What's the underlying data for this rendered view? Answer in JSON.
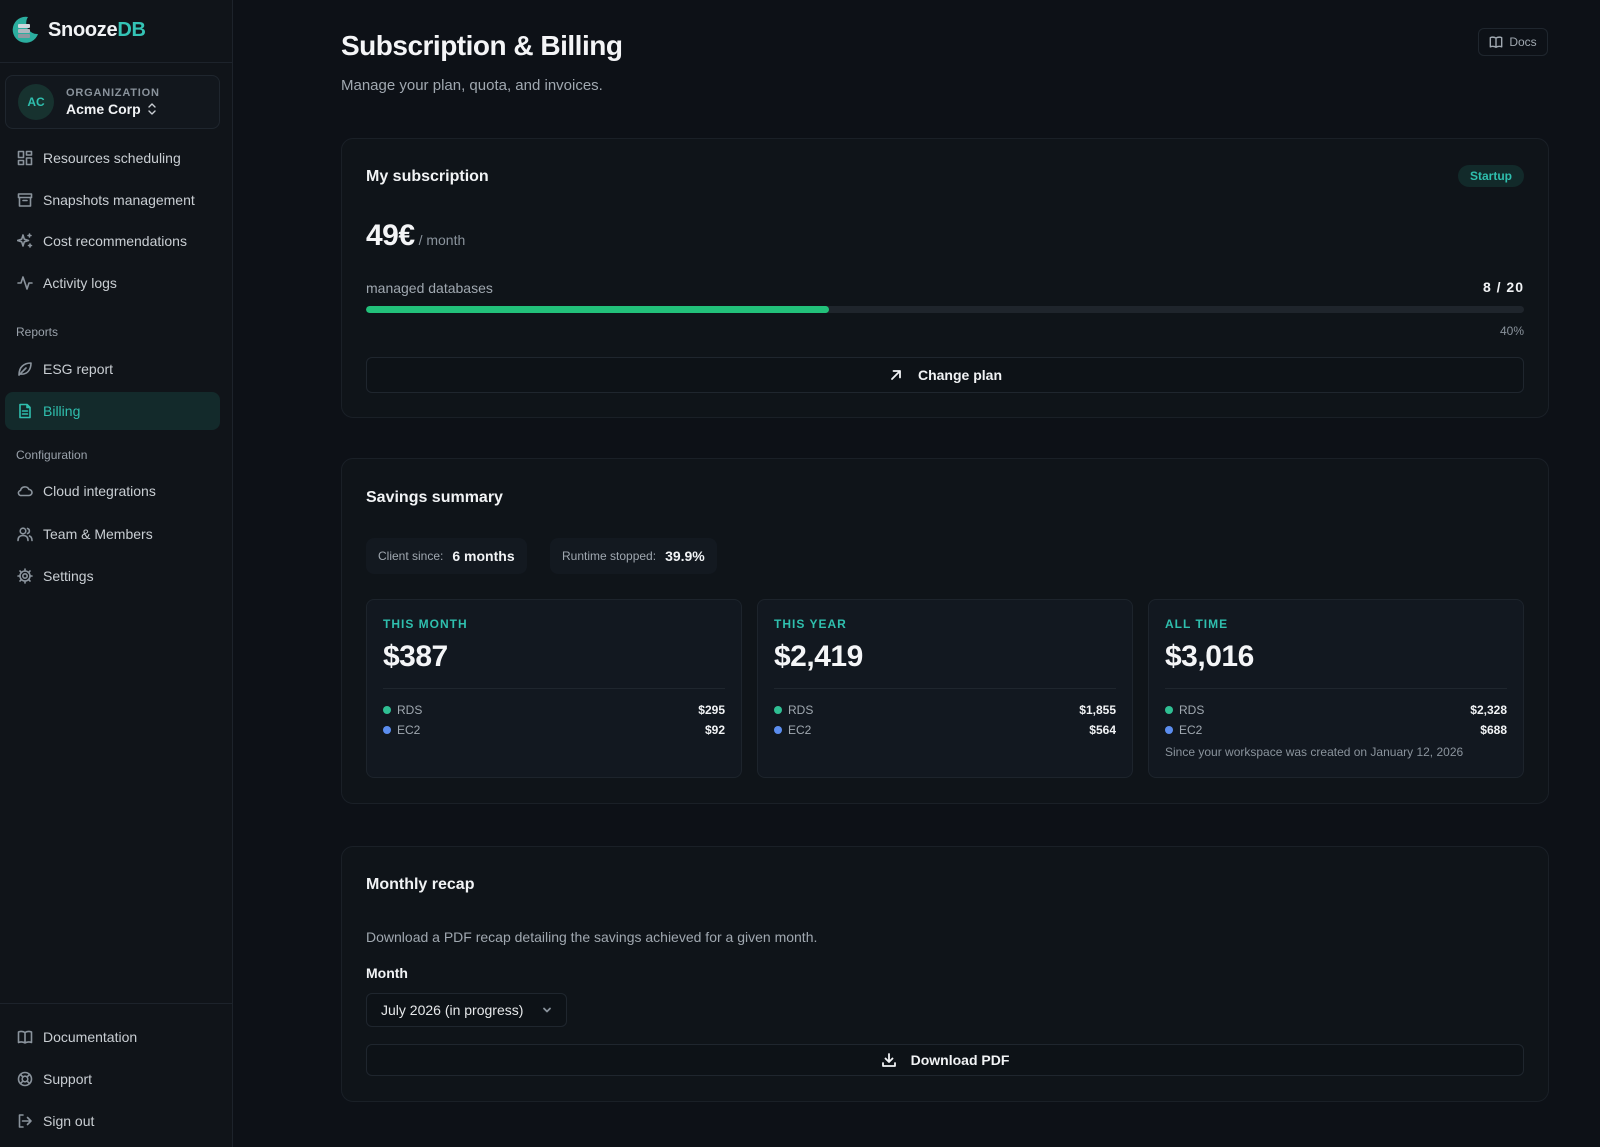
{
  "brand": {
    "name_part1": "Snooze",
    "name_part2": "DB",
    "accent_color": "#34c3b5"
  },
  "organization": {
    "caption": "ORGANIZATION",
    "initials": "AC",
    "name": "Acme Corp"
  },
  "sidebar": {
    "items": [
      {
        "label": "Resources scheduling",
        "icon": "grid-icon"
      },
      {
        "label": "Snapshots management",
        "icon": "archive-icon"
      },
      {
        "label": "Cost recommendations",
        "icon": "sparkles-icon"
      },
      {
        "label": "Activity logs",
        "icon": "activity-icon"
      }
    ],
    "reports_heading": "Reports",
    "reports": [
      {
        "label": "ESG report",
        "icon": "leaf-icon"
      },
      {
        "label": "Billing",
        "icon": "document-icon",
        "active": true
      }
    ],
    "configuration_heading": "Configuration",
    "configuration": [
      {
        "label": "Cloud integrations",
        "icon": "cloud-icon"
      },
      {
        "label": "Team & Members",
        "icon": "users-icon"
      },
      {
        "label": "Settings",
        "icon": "gear-icon"
      }
    ],
    "bottom": [
      {
        "label": "Documentation",
        "icon": "book-icon"
      },
      {
        "label": "Support",
        "icon": "lifebuoy-icon"
      },
      {
        "label": "Sign out",
        "icon": "sign-out-icon"
      }
    ]
  },
  "header": {
    "title": "Subscription & Billing",
    "subtitle": "Manage your plan, quota, and invoices.",
    "docs_label": "Docs"
  },
  "subscription": {
    "title": "My subscription",
    "plan": "Startup",
    "price": "49€",
    "period": "/ month",
    "quota_label": "managed databases",
    "quota_used": 8,
    "quota_total": 20,
    "quota_display": "8 / 20",
    "quota_fraction": 0.4,
    "quota_percent": "40%",
    "change_plan_label": "Change plan",
    "progress_color": "#22c17a"
  },
  "savings": {
    "title": "Savings summary",
    "client_since_label": "Client since:",
    "client_since_value": "6 months",
    "runtime_label": "Runtime stopped:",
    "runtime_value": "39.9%",
    "stats": [
      {
        "label": "THIS MONTH",
        "value": "$387",
        "rows": [
          {
            "name": "RDS",
            "amount": "$295"
          },
          {
            "name": "EC2",
            "amount": "$92"
          }
        ]
      },
      {
        "label": "THIS YEAR",
        "value": "$2,419",
        "rows": [
          {
            "name": "RDS",
            "amount": "$1,855"
          },
          {
            "name": "EC2",
            "amount": "$564"
          }
        ]
      },
      {
        "label": "ALL TIME",
        "value": "$3,016",
        "rows": [
          {
            "name": "RDS",
            "amount": "$2,328"
          },
          {
            "name": "EC2",
            "amount": "$688"
          }
        ],
        "note": "Since your workspace was created on January 12, 2026"
      }
    ],
    "rds_color": "#2fbf93",
    "ec2_color": "#5b8def"
  },
  "recap": {
    "title": "Monthly recap",
    "description": "Download a PDF recap detailing the savings achieved for a given month.",
    "month_label": "Month",
    "selected_month": "July 2026 (in progress)",
    "download_label": "Download PDF"
  }
}
